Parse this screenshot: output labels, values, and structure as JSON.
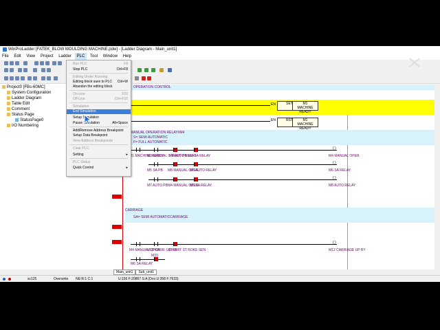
{
  "title_bar": {
    "text": "WinProLadder [FATEK_BLOW MOULDING MACHINE.pdw] - [Ladder Diagram - Main_unit1]"
  },
  "menu_bar": [
    "File",
    "Edit",
    "View",
    "Project",
    "Ladder",
    "PLC",
    "Tool",
    "Window",
    "Help"
  ],
  "plc_menu": [
    {
      "label": "Run PLC",
      "shortcut": "F8",
      "disabled": true
    },
    {
      "label": "Stop PLC",
      "shortcut": "Ctrl+F8",
      "disabled": false
    },
    {
      "label": "Editing Under Running",
      "shortcut": "",
      "disabled": true
    },
    {
      "label": "Editing block save to PLC",
      "shortcut": "Ctrl+W",
      "disabled": false
    },
    {
      "label": "Abandon the editing block",
      "shortcut": "",
      "disabled": false
    },
    {
      "label": "On-Line",
      "shortcut": "F10",
      "disabled": true
    },
    {
      "label": "Off-Line",
      "shortcut": "Ctrl+F10",
      "disabled": true
    },
    {
      "label": "Simulation",
      "shortcut": "",
      "disabled": true
    },
    {
      "label": "End Simulation",
      "shortcut": "",
      "disabled": false
    },
    {
      "label": "Setup Simulation",
      "shortcut": "",
      "disabled": false
    },
    {
      "label": "Pause Simulation",
      "shortcut": "Alt+Space",
      "disabled": false
    },
    {
      "label": "Add/Remove Address Breakpoint",
      "shortcut": "",
      "disabled": false
    },
    {
      "label": "Setup Data Breakpoint",
      "shortcut": "",
      "disabled": false
    },
    {
      "label": "View Address Breakpoints",
      "shortcut": "",
      "disabled": true
    },
    {
      "label": "Clear PLC",
      "shortcut": "",
      "disabled": true
    },
    {
      "label": "Setting",
      "shortcut": "▸",
      "disabled": false
    },
    {
      "label": "PLC Status",
      "shortcut": "",
      "disabled": true
    },
    {
      "label": "Quick Control",
      "shortcut": "▸",
      "disabled": false
    }
  ],
  "tree": [
    {
      "label": "Project0 [FBs-60MC]",
      "level": 0
    },
    {
      "label": "System Configuration",
      "level": 1
    },
    {
      "label": "Ladder Diagram",
      "level": 1
    },
    {
      "label": "Table Edit",
      "level": 1
    },
    {
      "label": "Comment",
      "level": 1
    },
    {
      "label": "Status Page",
      "level": 1
    },
    {
      "label": "StatusPage0",
      "level": 2
    },
    {
      "label": "I/O Numbering",
      "level": 1
    }
  ],
  "ladder": {
    "section1": "OPERATION CONTROL",
    "coil_set_op": "SET",
    "coil_set_label": "M1",
    "coil_set_desc": "MACHINE READY",
    "coil_rst_op": "RST",
    "coil_rst_label": "M1",
    "coil_rst_desc": "MACHINE READY",
    "en": "EN",
    "section2": "MANUAL OPERATION RELAY#M4",
    "semi_auto": "S= SEMI AUTOMATIC",
    "full_auto": "F= FULL AUTOMATIC",
    "rung3_contacts": [
      "M1 MACHINE READY",
      "M3 MANUAL O PERT. PB",
      "M8 AUTO RELAY",
      "M6 SA RELAY"
    ],
    "rung3_coil": "M4 MANUAL OPER.",
    "rung3b_contacts": [
      "M5 SA PB",
      "M8 MANUAL OPER.",
      "M6 AUTO RELAY"
    ],
    "rung3b_coil": "M6 SA RELAY",
    "rung3c_contacts": [
      "M7 AUTO PB",
      "M4 MANUAL OPER.",
      "M6 SA RELAY"
    ],
    "rung3c_coil": "M8 AUTO RELAY",
    "section3": "CARRIAGE",
    "sa_carriage": "SA= SEMI AUTOMATICCARRIAGE",
    "rung4_contacts": [
      "M4 MANUAL OPER.",
      "M13 CARR. UP PB",
      "X3 LIMIT ST ROKE SEN"
    ],
    "rung4b_contacts": [
      "M6 SA RELAY",
      "M33"
    ],
    "rung4_coil": "M12 CARRIAGE UP RY"
  },
  "tabs": [
    "Main_unit1",
    "Sub_unit1"
  ],
  "status": {
    "station": "sc125",
    "mode": "Overwrite",
    "position": "NE:R:1 C:1",
    "info": "U:156 F:20867 S:A (Doc:U:358 F:7633)"
  }
}
